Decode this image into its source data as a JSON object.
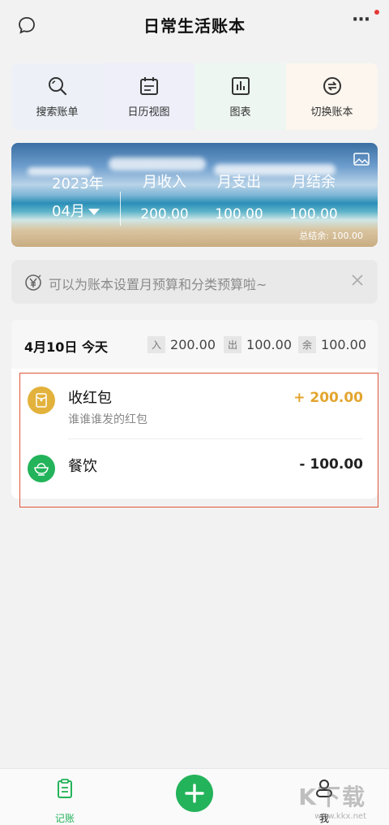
{
  "header": {
    "title": "日常生活账本",
    "more_label": "···"
  },
  "actions": [
    {
      "label": "搜索账单",
      "icon": "search-icon",
      "bg": "#edf1f7"
    },
    {
      "label": "日历视图",
      "icon": "calendar-icon",
      "bg": "#eeeff9"
    },
    {
      "label": "图表",
      "icon": "chart-icon",
      "bg": "#eef6f2"
    },
    {
      "label": "切换账本",
      "icon": "switch-icon",
      "bg": "#fcf6ee"
    }
  ],
  "banner": {
    "year": "2023年",
    "month": "04月",
    "income_label": "月收入",
    "income": "200.00",
    "expense_label": "月支出",
    "expense": "100.00",
    "balance_label": "月结余",
    "balance": "100.00",
    "total_balance": "总结余: 100.00"
  },
  "tip": {
    "text": "可以为账本设置月预算和分类预算啦~"
  },
  "day": {
    "date": "4月10日 今天",
    "in_tag": "入",
    "in": "200.00",
    "out_tag": "出",
    "out": "100.00",
    "rest_tag": "余",
    "rest": "100.00"
  },
  "records": [
    {
      "name": "收红包",
      "note": "谁谁谁发的红包",
      "amount": "+ 200.00",
      "color": "#e3b23c",
      "icon": "red-envelope-icon"
    },
    {
      "name": "餐饮",
      "note": "",
      "amount": "- 100.00",
      "color": "#23b35a",
      "icon": "rice-bowl-icon"
    }
  ],
  "tabbar": {
    "bookkeeping": "记账",
    "me": "我"
  },
  "watermark": {
    "main": "K下载",
    "sub": "www.kkx.net"
  },
  "colors": {
    "accent": "#23b35a",
    "income": "#e3a52f",
    "expense": "#222222"
  }
}
